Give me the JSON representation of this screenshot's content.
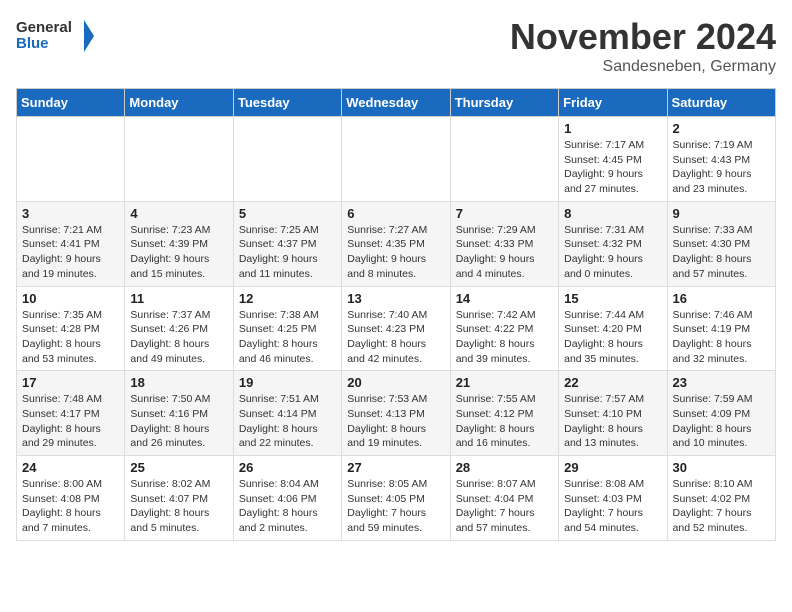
{
  "header": {
    "logo_general": "General",
    "logo_blue": "Blue",
    "month_title": "November 2024",
    "subtitle": "Sandesneben, Germany"
  },
  "weekdays": [
    "Sunday",
    "Monday",
    "Tuesday",
    "Wednesday",
    "Thursday",
    "Friday",
    "Saturday"
  ],
  "weeks": [
    [
      {
        "day": "",
        "detail": ""
      },
      {
        "day": "",
        "detail": ""
      },
      {
        "day": "",
        "detail": ""
      },
      {
        "day": "",
        "detail": ""
      },
      {
        "day": "",
        "detail": ""
      },
      {
        "day": "1",
        "detail": "Sunrise: 7:17 AM\nSunset: 4:45 PM\nDaylight: 9 hours and 27 minutes."
      },
      {
        "day": "2",
        "detail": "Sunrise: 7:19 AM\nSunset: 4:43 PM\nDaylight: 9 hours and 23 minutes."
      }
    ],
    [
      {
        "day": "3",
        "detail": "Sunrise: 7:21 AM\nSunset: 4:41 PM\nDaylight: 9 hours and 19 minutes."
      },
      {
        "day": "4",
        "detail": "Sunrise: 7:23 AM\nSunset: 4:39 PM\nDaylight: 9 hours and 15 minutes."
      },
      {
        "day": "5",
        "detail": "Sunrise: 7:25 AM\nSunset: 4:37 PM\nDaylight: 9 hours and 11 minutes."
      },
      {
        "day": "6",
        "detail": "Sunrise: 7:27 AM\nSunset: 4:35 PM\nDaylight: 9 hours and 8 minutes."
      },
      {
        "day": "7",
        "detail": "Sunrise: 7:29 AM\nSunset: 4:33 PM\nDaylight: 9 hours and 4 minutes."
      },
      {
        "day": "8",
        "detail": "Sunrise: 7:31 AM\nSunset: 4:32 PM\nDaylight: 9 hours and 0 minutes."
      },
      {
        "day": "9",
        "detail": "Sunrise: 7:33 AM\nSunset: 4:30 PM\nDaylight: 8 hours and 57 minutes."
      }
    ],
    [
      {
        "day": "10",
        "detail": "Sunrise: 7:35 AM\nSunset: 4:28 PM\nDaylight: 8 hours and 53 minutes."
      },
      {
        "day": "11",
        "detail": "Sunrise: 7:37 AM\nSunset: 4:26 PM\nDaylight: 8 hours and 49 minutes."
      },
      {
        "day": "12",
        "detail": "Sunrise: 7:38 AM\nSunset: 4:25 PM\nDaylight: 8 hours and 46 minutes."
      },
      {
        "day": "13",
        "detail": "Sunrise: 7:40 AM\nSunset: 4:23 PM\nDaylight: 8 hours and 42 minutes."
      },
      {
        "day": "14",
        "detail": "Sunrise: 7:42 AM\nSunset: 4:22 PM\nDaylight: 8 hours and 39 minutes."
      },
      {
        "day": "15",
        "detail": "Sunrise: 7:44 AM\nSunset: 4:20 PM\nDaylight: 8 hours and 35 minutes."
      },
      {
        "day": "16",
        "detail": "Sunrise: 7:46 AM\nSunset: 4:19 PM\nDaylight: 8 hours and 32 minutes."
      }
    ],
    [
      {
        "day": "17",
        "detail": "Sunrise: 7:48 AM\nSunset: 4:17 PM\nDaylight: 8 hours and 29 minutes."
      },
      {
        "day": "18",
        "detail": "Sunrise: 7:50 AM\nSunset: 4:16 PM\nDaylight: 8 hours and 26 minutes."
      },
      {
        "day": "19",
        "detail": "Sunrise: 7:51 AM\nSunset: 4:14 PM\nDaylight: 8 hours and 22 minutes."
      },
      {
        "day": "20",
        "detail": "Sunrise: 7:53 AM\nSunset: 4:13 PM\nDaylight: 8 hours and 19 minutes."
      },
      {
        "day": "21",
        "detail": "Sunrise: 7:55 AM\nSunset: 4:12 PM\nDaylight: 8 hours and 16 minutes."
      },
      {
        "day": "22",
        "detail": "Sunrise: 7:57 AM\nSunset: 4:10 PM\nDaylight: 8 hours and 13 minutes."
      },
      {
        "day": "23",
        "detail": "Sunrise: 7:59 AM\nSunset: 4:09 PM\nDaylight: 8 hours and 10 minutes."
      }
    ],
    [
      {
        "day": "24",
        "detail": "Sunrise: 8:00 AM\nSunset: 4:08 PM\nDaylight: 8 hours and 7 minutes."
      },
      {
        "day": "25",
        "detail": "Sunrise: 8:02 AM\nSunset: 4:07 PM\nDaylight: 8 hours and 5 minutes."
      },
      {
        "day": "26",
        "detail": "Sunrise: 8:04 AM\nSunset: 4:06 PM\nDaylight: 8 hours and 2 minutes."
      },
      {
        "day": "27",
        "detail": "Sunrise: 8:05 AM\nSunset: 4:05 PM\nDaylight: 7 hours and 59 minutes."
      },
      {
        "day": "28",
        "detail": "Sunrise: 8:07 AM\nSunset: 4:04 PM\nDaylight: 7 hours and 57 minutes."
      },
      {
        "day": "29",
        "detail": "Sunrise: 8:08 AM\nSunset: 4:03 PM\nDaylight: 7 hours and 54 minutes."
      },
      {
        "day": "30",
        "detail": "Sunrise: 8:10 AM\nSunset: 4:02 PM\nDaylight: 7 hours and 52 minutes."
      }
    ]
  ]
}
